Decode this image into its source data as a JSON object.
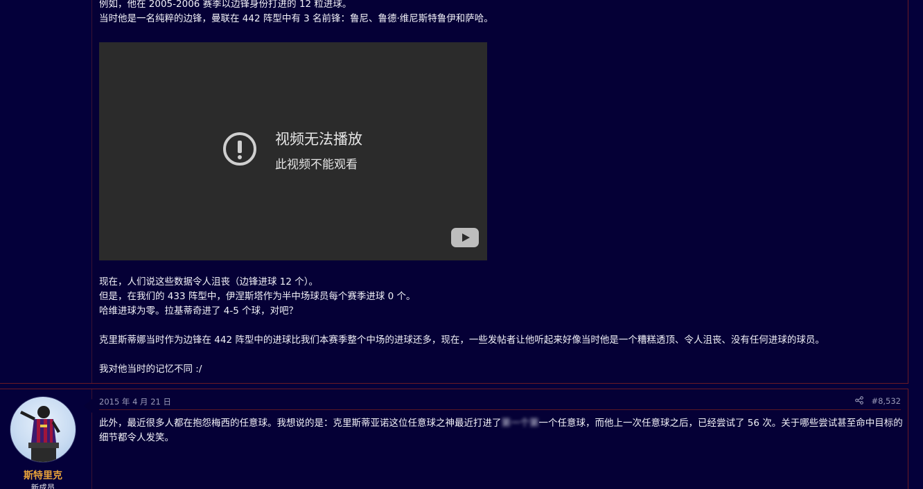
{
  "post1": {
    "lines_top": [
      "例如，他在 2005-2006 赛季以边锋身份打进的 12 粒进球。",
      "当时他是一名纯粹的边锋，曼联在 442 阵型中有 3 名前锋：鲁尼、鲁德·维尼斯特鲁伊和萨哈。"
    ],
    "video": {
      "error_title": "视频无法播放",
      "error_subtitle": "此视频不能观看",
      "icon": "exclamation-circle-icon",
      "play_icon": "youtube-play-icon"
    },
    "lines_bottom": [
      "现在，人们说这些数据令人沮丧（边锋进球 12 个）。",
      "但是，在我们的 433 阵型中，伊涅斯塔作为半中场球员每个赛季进球 0 个。",
      "哈维进球为零。拉基蒂奇进了 4-5 个球，对吧？"
    ],
    "paragraph_2": "克里斯蒂娜当时作为边锋在 442 阵型中的进球比我们本赛季整个中场的进球还多，现在，一些发帖者让他听起来好像当时他是一个糟糕透顶、令人沮丧、没有任何进球的球员。",
    "paragraph_3": "我对他当时的记忆不同 :/"
  },
  "post2": {
    "username": "斯特里克",
    "user_title": "新成员",
    "date": "2015 年 4 月 21 日",
    "post_number": "#8,532",
    "text_before": "此外，最近很多人都在抱怨梅西的任意球。我想说的是：克里斯蒂亚诺这位任意球之神最近打进了",
    "text_blurred": "第一个第",
    "text_after": "一个任意球，而他上一次任意球之后，已经尝试了 56 次。关于哪些尝试甚至命中目标的细节都令人发笑。"
  },
  "colors": {
    "background": "#04003a",
    "post_border": "#6b1a24",
    "username": "#e8a23a",
    "video_bg": "#2b2b2b"
  }
}
